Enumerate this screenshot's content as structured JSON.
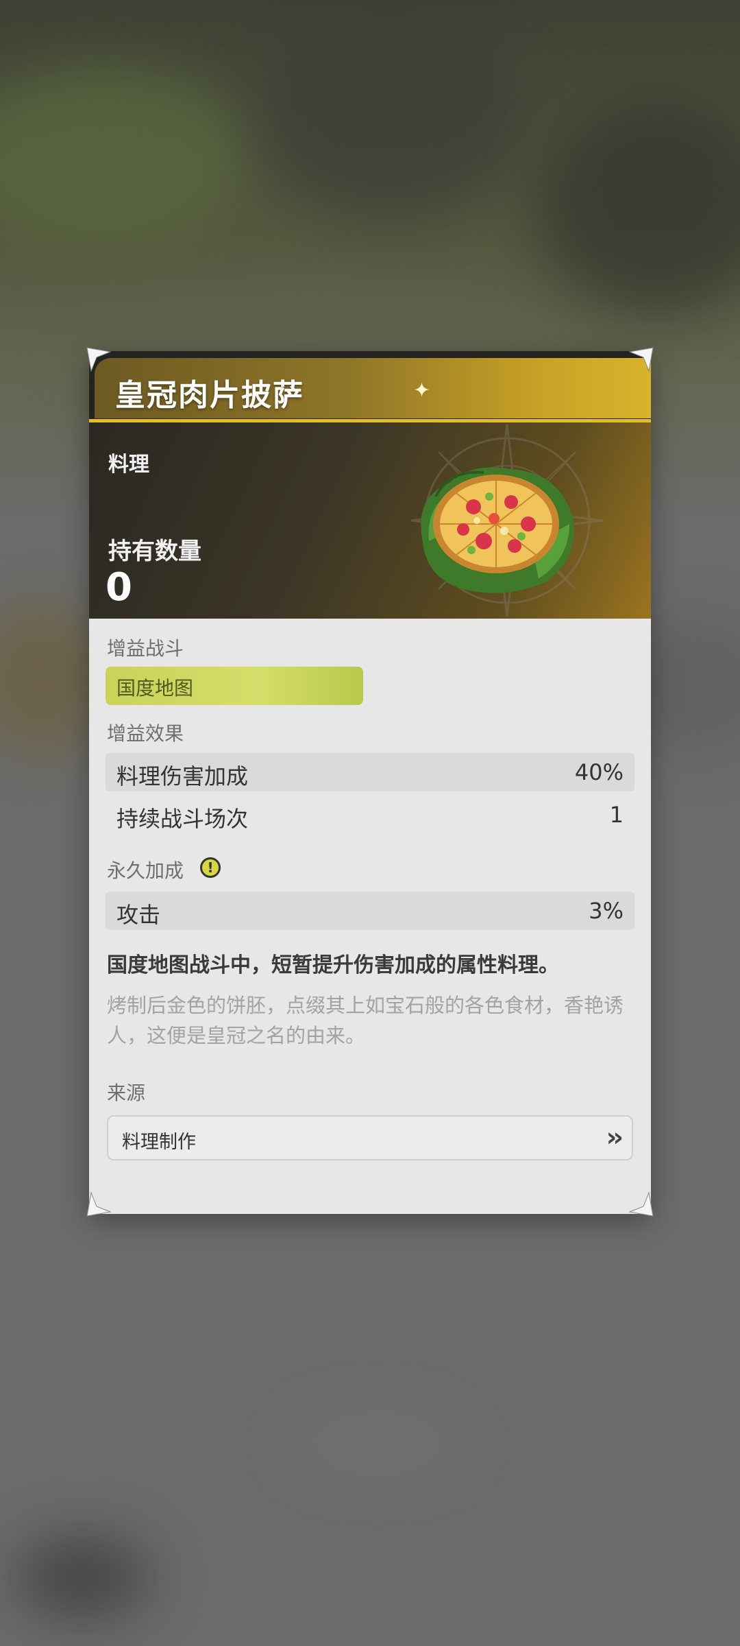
{
  "item": {
    "name": "皇冠肉片披萨",
    "category": "料理",
    "quantity_label": "持有数量",
    "quantity_value": "0"
  },
  "battle": {
    "label": "增益战斗",
    "tag": "国度地图"
  },
  "effects": {
    "label": "增益效果",
    "rows": [
      {
        "name": "料理伤害加成",
        "value": "40%"
      },
      {
        "name": "持续战斗场次",
        "value": "1"
      }
    ]
  },
  "permanent": {
    "label": "永久加成",
    "info_icon": "exclamation-circle-icon",
    "rows": [
      {
        "name": "攻击",
        "value": "3%"
      }
    ]
  },
  "description": "国度地图战斗中，短暂提升伤害加成的属性料理。",
  "flavor_text": "烤制后金色的饼胚，点缀其上如宝石般的各色食材，香艳诱人，这便是皇冠之名的由来。",
  "source": {
    "label": "来源",
    "button_label": "料理制作",
    "button_icon": "double-chevron-right-icon"
  },
  "colors": {
    "accent_gold": "#e2bd2a",
    "tag_green": "#c9d35a",
    "card_bg": "#e7e7e7"
  }
}
